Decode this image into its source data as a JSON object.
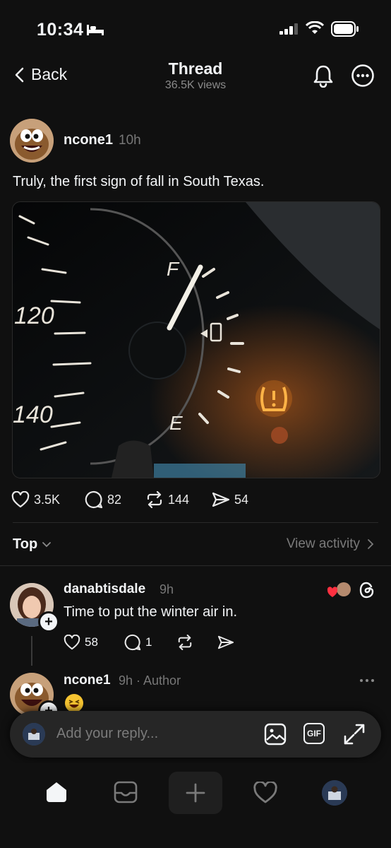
{
  "status_bar": {
    "time": "10:34"
  },
  "header": {
    "back_label": "Back",
    "title": "Thread",
    "views": "36.5K views"
  },
  "post": {
    "username": "ncone1",
    "time": "10h",
    "text": "Truly, the first sign of fall in South Texas.",
    "gauge_labels": {
      "speed_120": "120",
      "speed_140": "140",
      "fuel_full": "F",
      "fuel_empty": "E"
    },
    "likes": "3.5K",
    "comments": "82",
    "reposts": "144",
    "shares": "54"
  },
  "replies_header": {
    "sort_label": "Top",
    "view_activity": "View activity"
  },
  "replies": [
    {
      "username": "danabtisdale",
      "time": "9h",
      "text": "Time to put the winter air in.",
      "likes": "58",
      "comments": "1"
    },
    {
      "username": "ncone1",
      "time": "9h · Author"
    }
  ],
  "reply_bar": {
    "placeholder": "Add your reply...",
    "gif_label": "GIF"
  },
  "colors": {
    "background": "#101010",
    "text": "#f3f5f7",
    "muted": "#777777",
    "warning_orange": "#ff8a1c",
    "like_red": "#ff3040"
  }
}
